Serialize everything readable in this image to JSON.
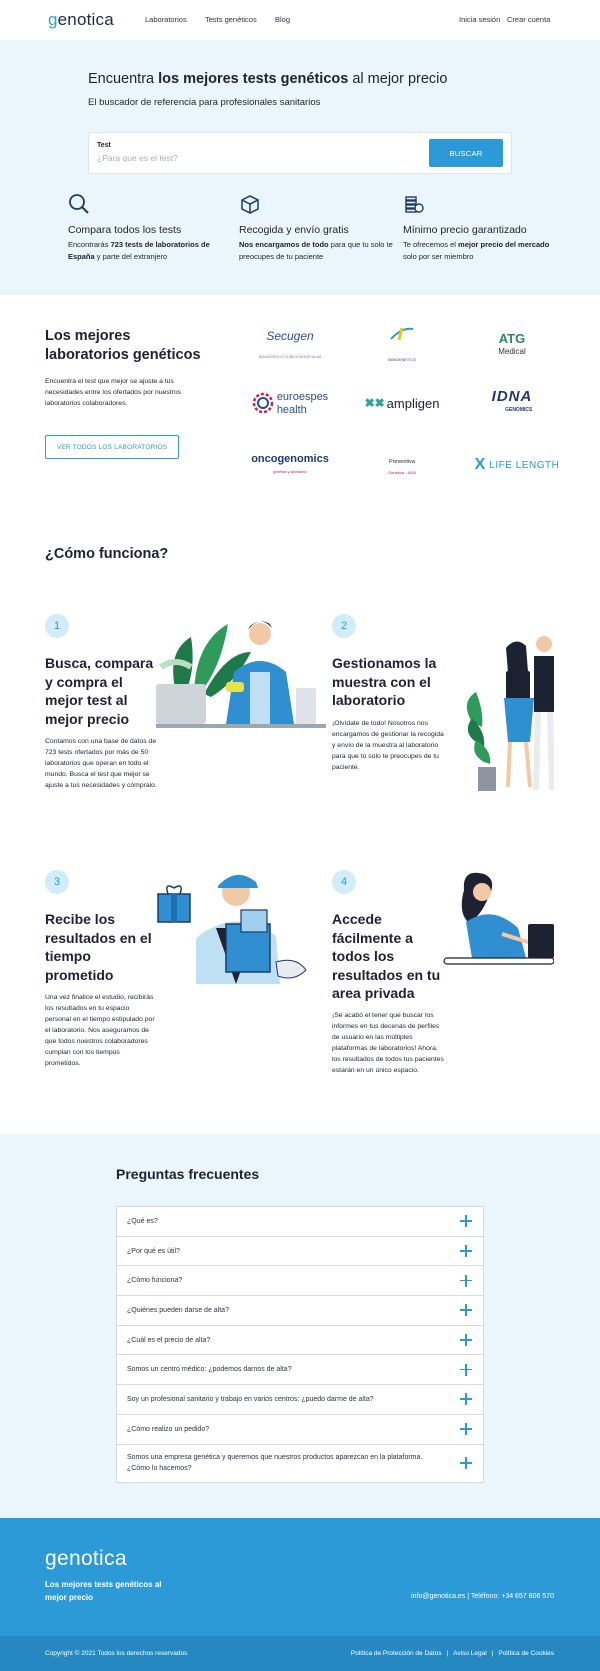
{
  "header": {
    "logo": "genotica",
    "nav": [
      "Laboratorios",
      "Tests genéticos",
      "Blog"
    ],
    "login": "Inicia sesión",
    "signup": "Crear cuenta"
  },
  "hero": {
    "title_pre": "Encuentra ",
    "title_bold": "los mejores tests genéticos",
    "title_post": " al mejor precio",
    "subtitle": "El buscador de referencia para profesionales sanitarios",
    "search_label": "Test",
    "search_placeholder": "¿Para que es el test?",
    "search_button": "BUSCAR"
  },
  "features": [
    {
      "icon": "search-icon",
      "title": "Compara todos los tests",
      "desc_pre": "Encontrarás ",
      "desc_bold": "723 tests de laboratorios de España",
      "desc_post": " y parte del extranjero"
    },
    {
      "icon": "box-icon",
      "title": "Recogida y envío gratis",
      "desc_pre": "",
      "desc_bold": "Nos encargamos de todo",
      "desc_post": " para que tu solo te preocupes de tu paciente"
    },
    {
      "icon": "coins-icon",
      "title": "Mínimo precio garantizado",
      "desc_pre": "Te ofrecemos el ",
      "desc_bold": "mejor precio del mercado",
      "desc_post": " solo por ser miembro"
    }
  ],
  "labs": {
    "title": "Los mejores laboratorios genéticos",
    "desc": "Encuentra el test que mejor se ajuste a tus necesidades entre los ofertados por nuestros laboratorios colaboradores.",
    "button": "VER TODOS LOS LABORATORIOS",
    "logos": [
      {
        "name": "Secugen",
        "tag": "DIAGNÓSTICO CLÍNICO MOLECULAR"
      },
      {
        "name": "NIMGENETICS",
        "tag": ""
      },
      {
        "name": "ATG",
        "tag": "Medical"
      },
      {
        "name": "euroespes",
        "tag": "health"
      },
      {
        "name": "ampligen",
        "tag": ""
      },
      {
        "name": "IDNA",
        "tag": "GENOMICS"
      },
      {
        "name": "oncogenomics",
        "tag": "genética y laboratorio"
      },
      {
        "name": "Preventiva",
        "tag": "Genética · ADN"
      },
      {
        "name": "LIFE LENGTH",
        "tag": ""
      }
    ]
  },
  "how": {
    "title": "¿Cómo funciona?",
    "steps": [
      {
        "num": "1",
        "title": "Busca, compara y compra el mejor test al mejor precio",
        "desc": "Contamos con una base de datos de 723 tests ofertados por más de 50 laboratorios que operan en todo el mundo. Busca el test que mejor se ajuste a tus necesidades y cómpralo."
      },
      {
        "num": "2",
        "title": "Gestionamos la muestra con el laboratorio",
        "desc": "¡Olvídate de todo! Nosotros nos encargamos de gestionar la recogida y envío de la muestra al laboratorio para que tú solo te preocupes de tu paciente."
      },
      {
        "num": "3",
        "title": "Recibe los resultados en el tiempo prometido",
        "desc": "Una vez finalice el estudio, recibirás los resultados en tu espacio personal en el tiempo estipulado por el laboratorio. Nos aseguramos de que todos nuestros colaboradores cumplan con los tiempos prometidos."
      },
      {
        "num": "4",
        "title": "Accede fácilmente a todos los resultados en tu area privada",
        "desc": "¡Se acabó el tener que buscar los informes en tus decenas de perfiles de usuario en las múltiples plataformas de laboratorios! Ahora, los resultados de todos tus pacientes estarán en un único espacio."
      }
    ]
  },
  "faq": {
    "title": "Preguntas frecuentes",
    "items": [
      "¿Qué es?",
      "¿Por qué es útil?",
      "¿Cómo funciona?",
      "¿Quiénes pueden darse de alta?",
      "¿Cuál es el precio de alta?",
      "Somos un centro médico: ¿podemos darnos de alta?",
      "Soy un profesional sanitario y trabajo en varios centros: ¿puedo darme de alta?",
      "¿Cómo realizo un pedido?",
      "Somos una empresa genética y queremos que nuestros productos aparezcan en la plataforma. ¿Cómo lo hacemos?"
    ]
  },
  "footer": {
    "logo": "genotica",
    "tagline": "Los mejores tests genéticos al mejor precio",
    "contact": "info@genotica.es | Teléfono: +34 657 806 570",
    "copyright": "Copyright © 2021 Todos los derechos reservados",
    "legal": [
      "Política de Protección de Datos",
      "Aviso Legal",
      "Política de Cookies"
    ]
  },
  "colors": {
    "accent": "#2c9ad6",
    "hero_bg": "#eaf5fc",
    "text": "#1c2232"
  }
}
